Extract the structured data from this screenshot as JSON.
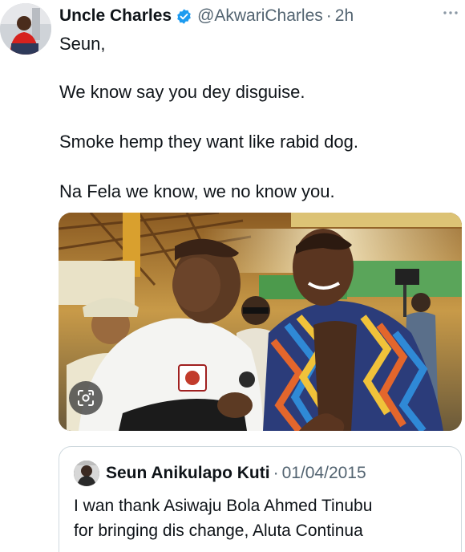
{
  "tweet": {
    "author_name": "Uncle Charles",
    "handle": "@AkwariCharles",
    "separator": "·",
    "time": "2h",
    "lines": [
      "Seun,",
      "We know say you dey disguise.",
      "Smoke hemp they want like rabid dog.",
      "Na Fela we know, we no know you."
    ]
  },
  "icons": {
    "verified": "verified-badge-icon",
    "more": "more-options-icon",
    "lens": "visual-search-icon"
  },
  "quoted_tweet": {
    "author_name": "Seun Anikulapo Kuti",
    "separator": "·",
    "date": "01/04/2015",
    "lines": [
      "I wan thank Asiwaju Bola Ahmed Tinubu",
      "for bringing dis change, Aluta Continua"
    ]
  },
  "colors": {
    "verified_blue": "#1d9bf0",
    "secondary_text": "#536471",
    "primary_text": "#0f1419",
    "border": "#cfd9de"
  }
}
